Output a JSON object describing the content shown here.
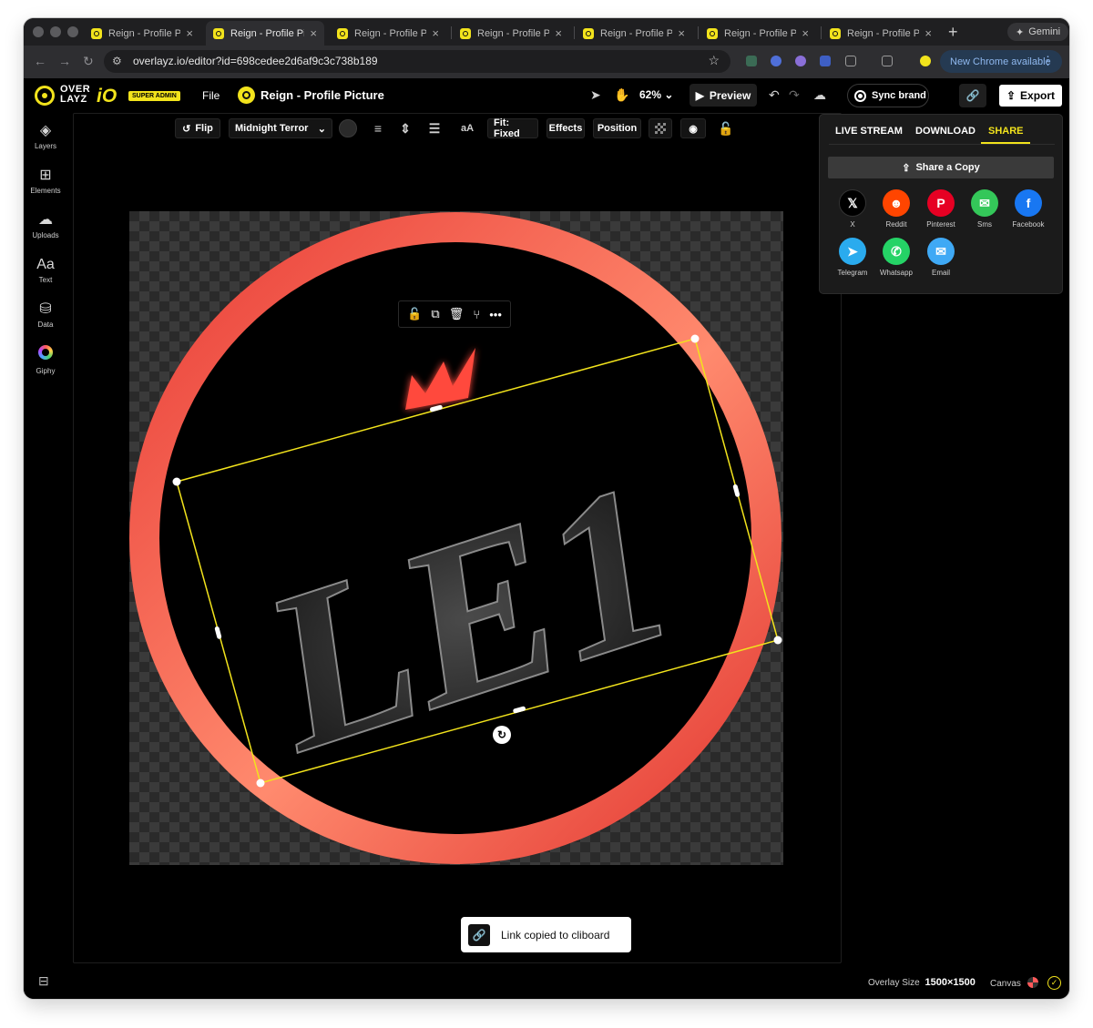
{
  "browser": {
    "tabs": [
      {
        "title": "Reign - Profile Picture"
      },
      {
        "title": "Reign - Profile Picture"
      },
      {
        "title": "Reign - Profile Picture"
      },
      {
        "title": "Reign - Profile Picture"
      },
      {
        "title": "Reign - Profile Picture"
      },
      {
        "title": "Reign - Profile Picture"
      },
      {
        "title": "Reign - Profile Picture"
      }
    ],
    "active_tab_index": 1,
    "gemini_label": "Gemini",
    "url": "overlayz.io/editor?id=698cedee2d6af9c3c738b189",
    "update_label": "New Chrome available"
  },
  "app": {
    "logo_top": "OVER",
    "logo_bottom": "LAYZ",
    "logo_io": "iO",
    "badge": "SUPER ADMIN",
    "file_menu": "File",
    "project_title": "Reign - Profile Picture",
    "zoom": "62%",
    "preview_label": "Preview",
    "sync_brand_label": "Sync brand",
    "export_label": "Export"
  },
  "sidebar": {
    "items": [
      {
        "label": "Layers",
        "icon": "layers-icon"
      },
      {
        "label": "Elements",
        "icon": "elements-icon"
      },
      {
        "label": "Uploads",
        "icon": "upload-cloud-icon"
      },
      {
        "label": "Text",
        "icon": "text-icon"
      },
      {
        "label": "Data",
        "icon": "data-icon"
      },
      {
        "label": "Giphy",
        "icon": "giphy-icon"
      }
    ]
  },
  "toolbar": {
    "flip_label": "Flip",
    "font_name": "Midnight Terror",
    "case_label": "aA",
    "fit_label": "Fit: Fixed",
    "effects_label": "Effects",
    "position_label": "Position"
  },
  "canvas": {
    "text": "LE1",
    "ring_color": "#ef4a44",
    "crown_color": "#ff4a3d",
    "selection_color": "#f2e31c"
  },
  "toast": {
    "message": "Link copied to cliboard"
  },
  "share_panel": {
    "tabs": [
      "LIVE STREAM",
      "DOWNLOAD",
      "SHARE"
    ],
    "active_tab": "SHARE",
    "share_copy_label": "Share a Copy",
    "targets": [
      {
        "label": "X",
        "color": "#000000",
        "glyph": "𝕏"
      },
      {
        "label": "Reddit",
        "color": "#ff4500",
        "glyph": "●"
      },
      {
        "label": "Pinterest",
        "color": "#e60023",
        "glyph": "P"
      },
      {
        "label": "Sms",
        "color": "#34c759",
        "glyph": "✉"
      },
      {
        "label": "Facebook",
        "color": "#1877f2",
        "glyph": "f"
      },
      {
        "label": "Telegram",
        "color": "#2aabee",
        "glyph": "➤"
      },
      {
        "label": "Whatsapp",
        "color": "#25d366",
        "glyph": "✆"
      },
      {
        "label": "Email",
        "color": "#3fa9f5",
        "glyph": "✉"
      }
    ]
  },
  "footer": {
    "overlay_size_label": "Overlay Size",
    "overlay_size_value": "1500×1500",
    "canvas_label": "Canvas"
  }
}
